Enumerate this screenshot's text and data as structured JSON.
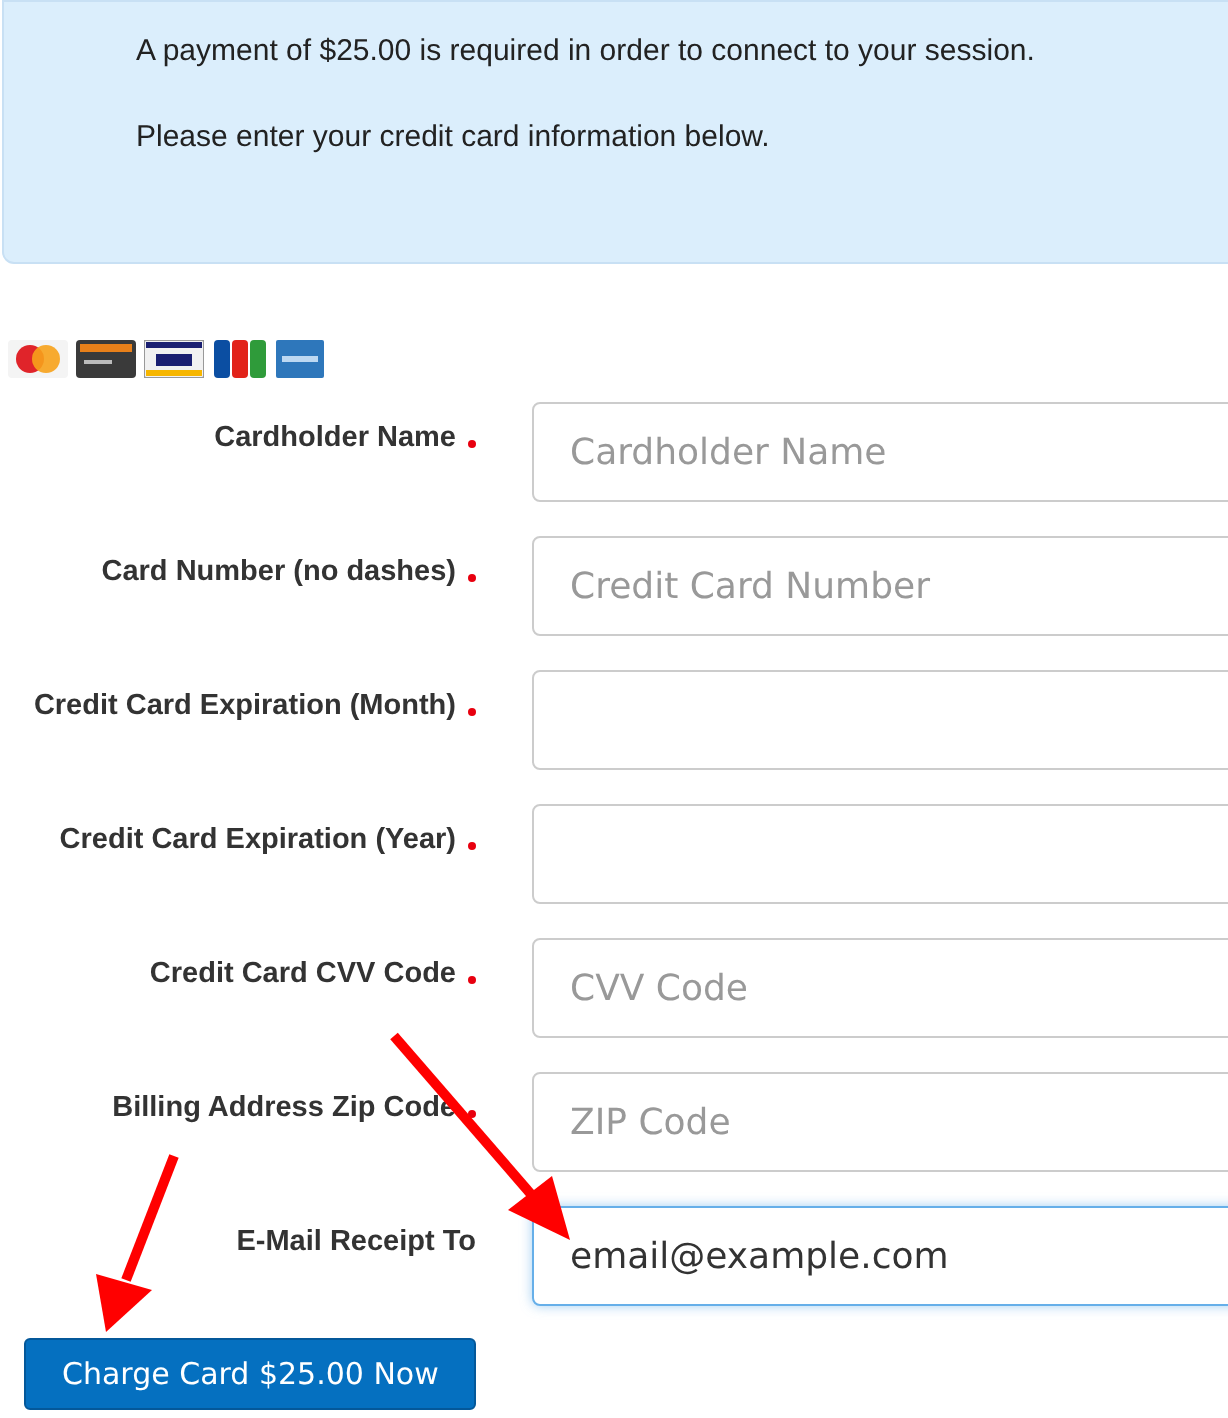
{
  "notice": {
    "lines": [
      "A payment of $25.00 is required in order to connect to your session.",
      "Please enter your credit card information below."
    ]
  },
  "fields": [
    {
      "label": "Cardholder Name",
      "required": true,
      "placeholder": "Cardholder Name",
      "focused": false
    },
    {
      "label": "Card Number (no dashes)",
      "required": true,
      "placeholder": "Credit Card Number",
      "focused": false
    },
    {
      "label": "Credit Card Expiration (Month)",
      "required": true,
      "focused": false
    },
    {
      "label": "Credit Card Expiration (Year)",
      "required": true,
      "focused": false
    },
    {
      "label": "Credit Card CVV Code",
      "required": true,
      "placeholder": "CVV Code",
      "focused": false
    },
    {
      "label": "Billing Address Zip Code",
      "required": true,
      "placeholder": "ZIP Code",
      "focused": false
    },
    {
      "label": "E-Mail Receipt To",
      "required": false,
      "value": "email@example.com",
      "focused": true
    }
  ],
  "submit": {
    "label": "Charge Card $25.00 Now"
  }
}
